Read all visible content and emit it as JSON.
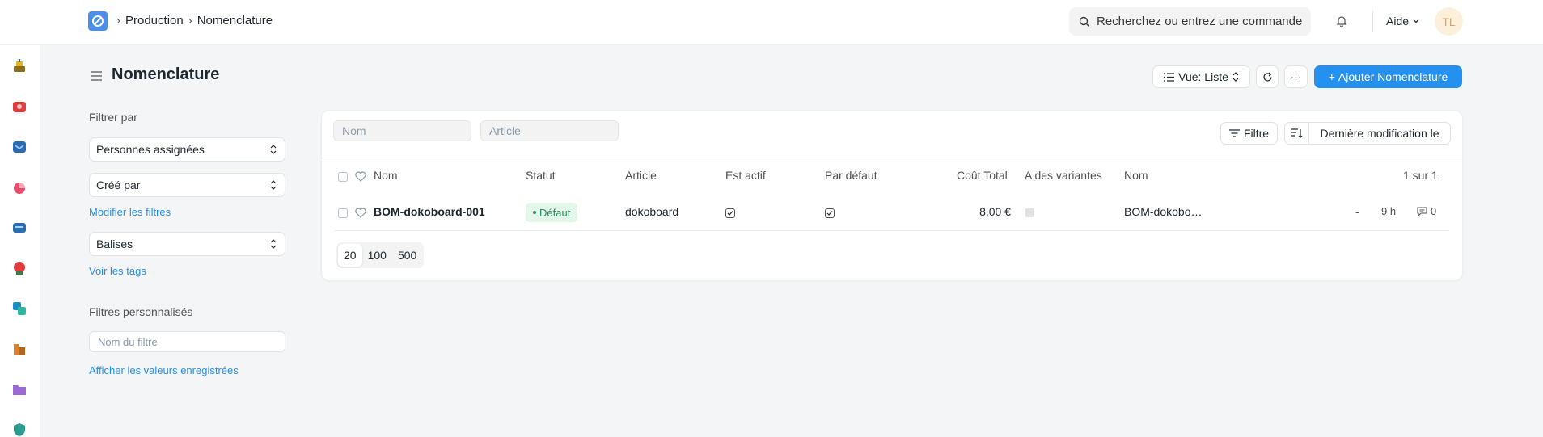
{
  "navbar": {
    "breadcrumb": [
      "Production",
      "Nomenclature"
    ],
    "search_placeholder": "Recherchez ou entrez une commande",
    "help_label": "Aide",
    "avatar_initials": "TL"
  },
  "rail_icons": [
    "manufacturing-icon",
    "quality-icon",
    "support-icon",
    "crm-icon",
    "assets-icon",
    "hr-icon",
    "projects-icon",
    "buildings-icon",
    "folder-icon",
    "shield-icon"
  ],
  "page": {
    "title": "Nomenclature",
    "view_label": "Vue: Liste",
    "more_label": "···",
    "add_label": "Ajouter Nomenclature",
    "add_plus": "+"
  },
  "sidebar": {
    "filter_by": "Filtrer par",
    "assigned_to": "Personnes assignées",
    "created_by": "Créé par",
    "edit_filters": "Modifier les filtres",
    "tags": "Balises",
    "show_tags": "Voir les tags",
    "custom_filters": "Filtres personnalisés",
    "filter_name_placeholder": "Nom du filtre",
    "show_saved": "Afficher les valeurs enregistrées"
  },
  "list": {
    "name_placeholder": "Nom",
    "item_placeholder": "Article",
    "filter_label": "Filtre",
    "sort_label": "Dernière modification le",
    "columns": {
      "name": "Nom",
      "status": "Statut",
      "item": "Article",
      "is_active": "Est actif",
      "is_default": "Par défaut",
      "total_cost": "Coût Total",
      "has_variants": "A des variantes",
      "name2": "Nom",
      "count": "1 sur 1"
    },
    "rows": [
      {
        "name": "BOM-dokoboard-001",
        "status": "Défaut",
        "item": "dokoboard",
        "is_active": true,
        "is_default": true,
        "total_cost": "8,00 €",
        "has_variants": false,
        "name2": "BOM-dokobo…",
        "dash": "-",
        "modified": "9 h",
        "comments": "0"
      }
    ],
    "page_sizes": [
      "20",
      "100",
      "500"
    ]
  },
  "colors": {
    "primary": "#2490ef",
    "status_green": "#278f5e",
    "status_green_bg": "#e4f5e9"
  }
}
